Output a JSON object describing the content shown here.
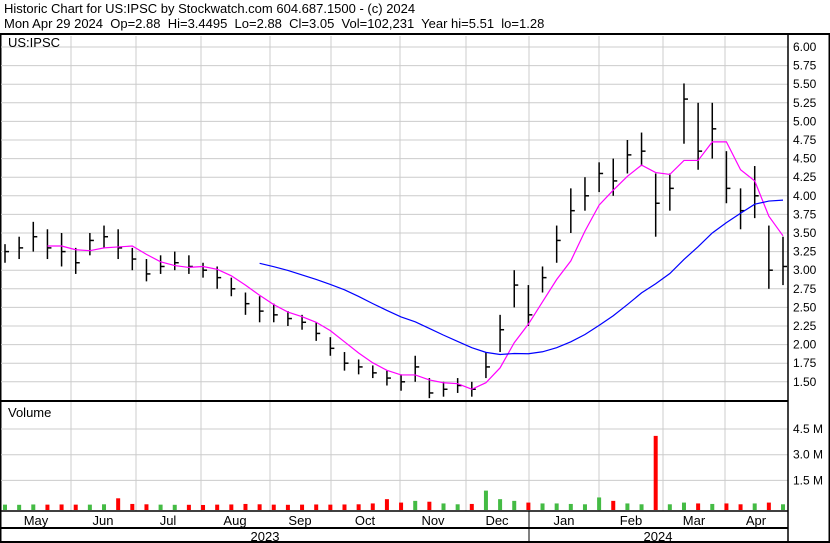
{
  "header": {
    "line1": "Historic Chart for US:IPSC by Stockwatch.com 604.687.1500 - (c) 2024",
    "line2": "Mon Apr 29 2024  Op=2.88  Hi=3.4495  Lo=2.88  Cl=3.05  Vol=102,231  Year hi=5.51  lo=1.28"
  },
  "chart_data": [
    {
      "type": "ohlc",
      "title": "US:IPSC",
      "ylim": [
        1.25,
        6.25
      ],
      "yticks": [
        "6.00",
        "5.75",
        "5.50",
        "5.25",
        "5.00",
        "4.75",
        "4.50",
        "4.25",
        "4.00",
        "3.75",
        "3.50",
        "3.25",
        "3.00",
        "2.75",
        "2.50",
        "2.25",
        "2.00",
        "1.75",
        "1.50"
      ],
      "ma_short_periods": 4,
      "ma_long_periods": 19,
      "colors": {
        "bar": "#000000",
        "ma_short": "#ff00ff",
        "ma_long": "#0000ff",
        "up": "#44bb44",
        "down": "#ff0000"
      },
      "bars": [
        [
          3.25,
          3.35,
          3.1,
          0.08
        ],
        [
          3.3,
          3.45,
          3.15,
          0.07
        ],
        [
          3.45,
          3.65,
          3.25,
          0.09
        ],
        [
          3.3,
          3.55,
          3.15,
          0.08
        ],
        [
          3.25,
          3.5,
          3.05,
          0.09
        ],
        [
          3.1,
          3.3,
          2.95,
          0.08
        ],
        [
          3.4,
          3.5,
          3.2,
          0.08
        ],
        [
          3.45,
          3.6,
          3.3,
          0.1
        ],
        [
          3.3,
          3.55,
          3.15,
          0.45
        ],
        [
          3.15,
          3.3,
          3.0,
          0.12
        ],
        [
          2.95,
          3.15,
          2.85,
          0.1
        ],
        [
          3.05,
          3.2,
          2.95,
          0.08
        ],
        [
          3.1,
          3.25,
          3.0,
          0.07
        ],
        [
          3.05,
          3.2,
          2.95,
          0.07
        ],
        [
          3.0,
          3.1,
          2.9,
          0.06
        ],
        [
          2.9,
          3.05,
          2.75,
          0.08
        ],
        [
          2.75,
          2.9,
          2.65,
          0.09
        ],
        [
          2.55,
          2.7,
          2.4,
          0.12
        ],
        [
          2.45,
          2.65,
          2.3,
          0.1
        ],
        [
          2.4,
          2.55,
          2.3,
          0.08
        ],
        [
          2.35,
          2.45,
          2.25,
          0.07
        ],
        [
          2.3,
          2.4,
          2.2,
          0.08
        ],
        [
          2.15,
          2.3,
          2.05,
          0.09
        ],
        [
          1.95,
          2.1,
          1.85,
          0.08
        ],
        [
          1.75,
          1.9,
          1.65,
          0.09
        ],
        [
          1.7,
          1.8,
          1.6,
          0.1
        ],
        [
          1.62,
          1.72,
          1.55,
          0.15
        ],
        [
          1.55,
          1.65,
          1.45,
          0.4
        ],
        [
          1.5,
          1.6,
          1.38,
          0.2
        ],
        [
          1.7,
          1.85,
          1.5,
          0.3
        ],
        [
          1.35,
          1.55,
          1.28,
          0.25
        ],
        [
          1.4,
          1.5,
          1.3,
          0.15
        ],
        [
          1.45,
          1.55,
          1.35,
          0.1
        ],
        [
          1.4,
          1.5,
          1.3,
          0.12
        ],
        [
          1.7,
          1.9,
          1.55,
          0.9
        ],
        [
          2.2,
          2.4,
          1.9,
          0.4
        ],
        [
          2.8,
          3.0,
          2.5,
          0.3
        ],
        [
          2.4,
          2.8,
          2.25,
          0.2
        ],
        [
          2.9,
          3.05,
          2.7,
          0.15
        ],
        [
          3.4,
          3.6,
          3.1,
          0.15
        ],
        [
          3.8,
          4.1,
          3.5,
          0.12
        ],
        [
          4.0,
          4.25,
          3.8,
          0.1
        ],
        [
          4.3,
          4.45,
          4.05,
          0.5
        ],
        [
          4.2,
          4.5,
          4.0,
          0.3
        ],
        [
          4.55,
          4.75,
          4.3,
          0.15
        ],
        [
          4.6,
          4.85,
          4.4,
          0.1
        ],
        [
          3.9,
          4.3,
          3.45,
          4.1
        ],
        [
          4.1,
          4.3,
          3.8,
          0.1
        ],
        [
          5.3,
          5.51,
          4.7,
          0.2
        ],
        [
          4.6,
          5.25,
          4.35,
          0.15
        ],
        [
          4.9,
          5.25,
          4.5,
          0.12
        ],
        [
          4.1,
          4.6,
          3.9,
          0.15
        ],
        [
          3.8,
          4.1,
          3.55,
          0.1
        ],
        [
          4.0,
          4.4,
          3.7,
          0.15
        ],
        [
          3.0,
          3.6,
          2.75,
          0.2
        ],
        [
          3.05,
          3.45,
          2.8,
          0.1
        ]
      ]
    },
    {
      "type": "bar",
      "title": "Volume",
      "ylim": [
        0,
        6
      ],
      "yticks": [
        "4.5 M",
        "3.0 M",
        "1.5 M"
      ],
      "ytick_values": [
        4.5,
        3.0,
        1.5
      ]
    }
  ],
  "xaxis": {
    "months": [
      "May",
      "Jun",
      "Jul",
      "Aug",
      "Sep",
      "Oct",
      "Nov",
      "Dec",
      "Jan",
      "Feb",
      "Mar",
      "Apr"
    ],
    "years": [
      "2023",
      "2024"
    ]
  }
}
